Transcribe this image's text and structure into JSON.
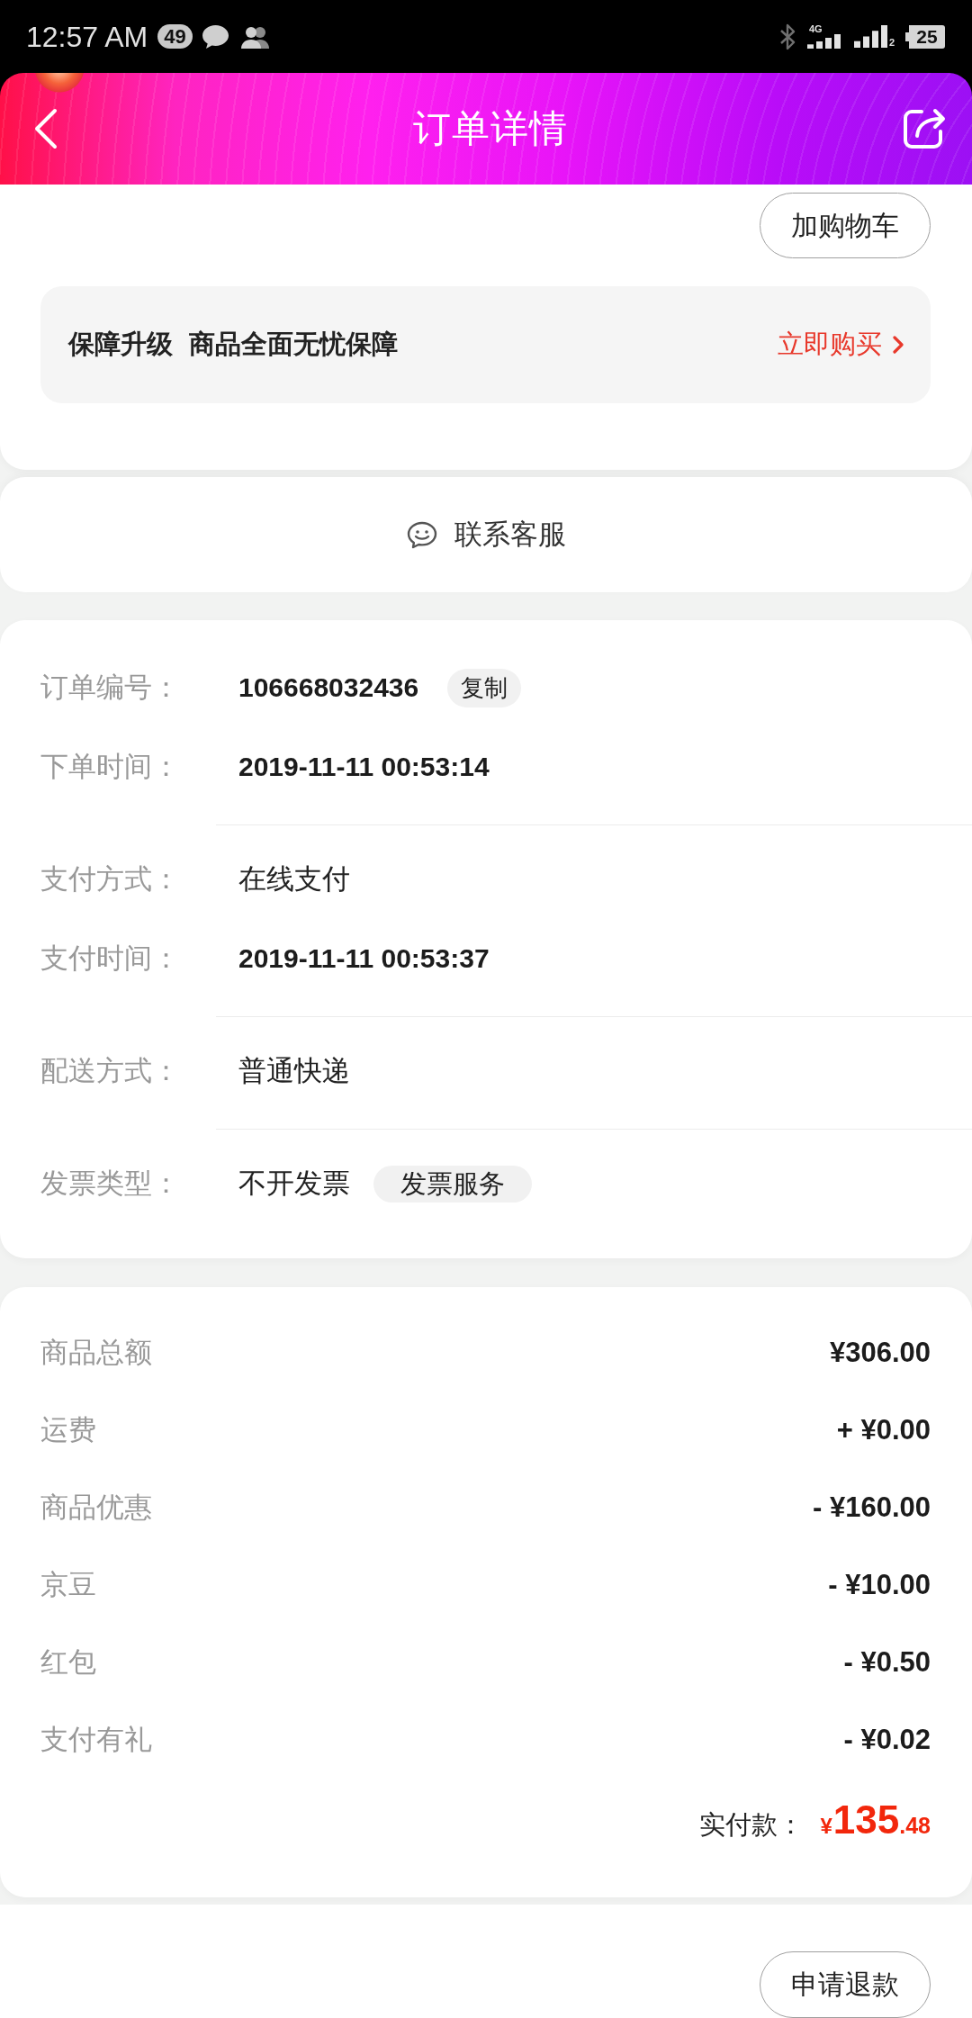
{
  "status_bar": {
    "time": "12:57 AM",
    "notification_count": "49",
    "network_type": "4G",
    "sim_slot": "2",
    "battery": "25"
  },
  "header": {
    "title": "订单详情"
  },
  "product_card": {
    "add_to_cart_button": "加购物车",
    "protection_banner": {
      "title": "保障升级",
      "description": "商品全面无忧保障",
      "action": "立即购买"
    }
  },
  "contact_service": {
    "label": "联系客服"
  },
  "order_info": {
    "groups": [
      {
        "rows": [
          {
            "label": "订单编号：",
            "value": "106668032436",
            "kind": "numeric",
            "tag": {
              "label": "复制",
              "kind": "copy"
            }
          },
          {
            "label": "下单时间：",
            "value": "2019-11-11 00:53:14",
            "kind": "numeric"
          }
        ]
      },
      {
        "rows": [
          {
            "label": "支付方式：",
            "value": "在线支付",
            "kind": "text"
          },
          {
            "label": "支付时间：",
            "value": "2019-11-11 00:53:37",
            "kind": "numeric"
          }
        ]
      },
      {
        "rows": [
          {
            "label": "配送方式：",
            "value": "普通快递",
            "kind": "text"
          }
        ]
      },
      {
        "rows": [
          {
            "label": "发票类型：",
            "value": "不开发票",
            "kind": "text",
            "tag": {
              "label": "发票服务",
              "kind": "service"
            }
          }
        ]
      }
    ]
  },
  "price_summary": {
    "rows": [
      {
        "label": "商品总额",
        "value": "¥306.00"
      },
      {
        "label": "运费",
        "value": "+ ¥0.00"
      },
      {
        "label": "商品优惠",
        "value": "- ¥160.00"
      },
      {
        "label": "京豆",
        "value": "- ¥10.00"
      },
      {
        "label": "红包",
        "value": "- ¥0.50"
      },
      {
        "label": "支付有礼",
        "value": "- ¥0.02"
      }
    ],
    "total": {
      "label": "实付款：",
      "currency": "¥",
      "integer": "135",
      "decimal": ".48"
    }
  },
  "bottom_bar": {
    "refund_button": "申请退款"
  }
}
